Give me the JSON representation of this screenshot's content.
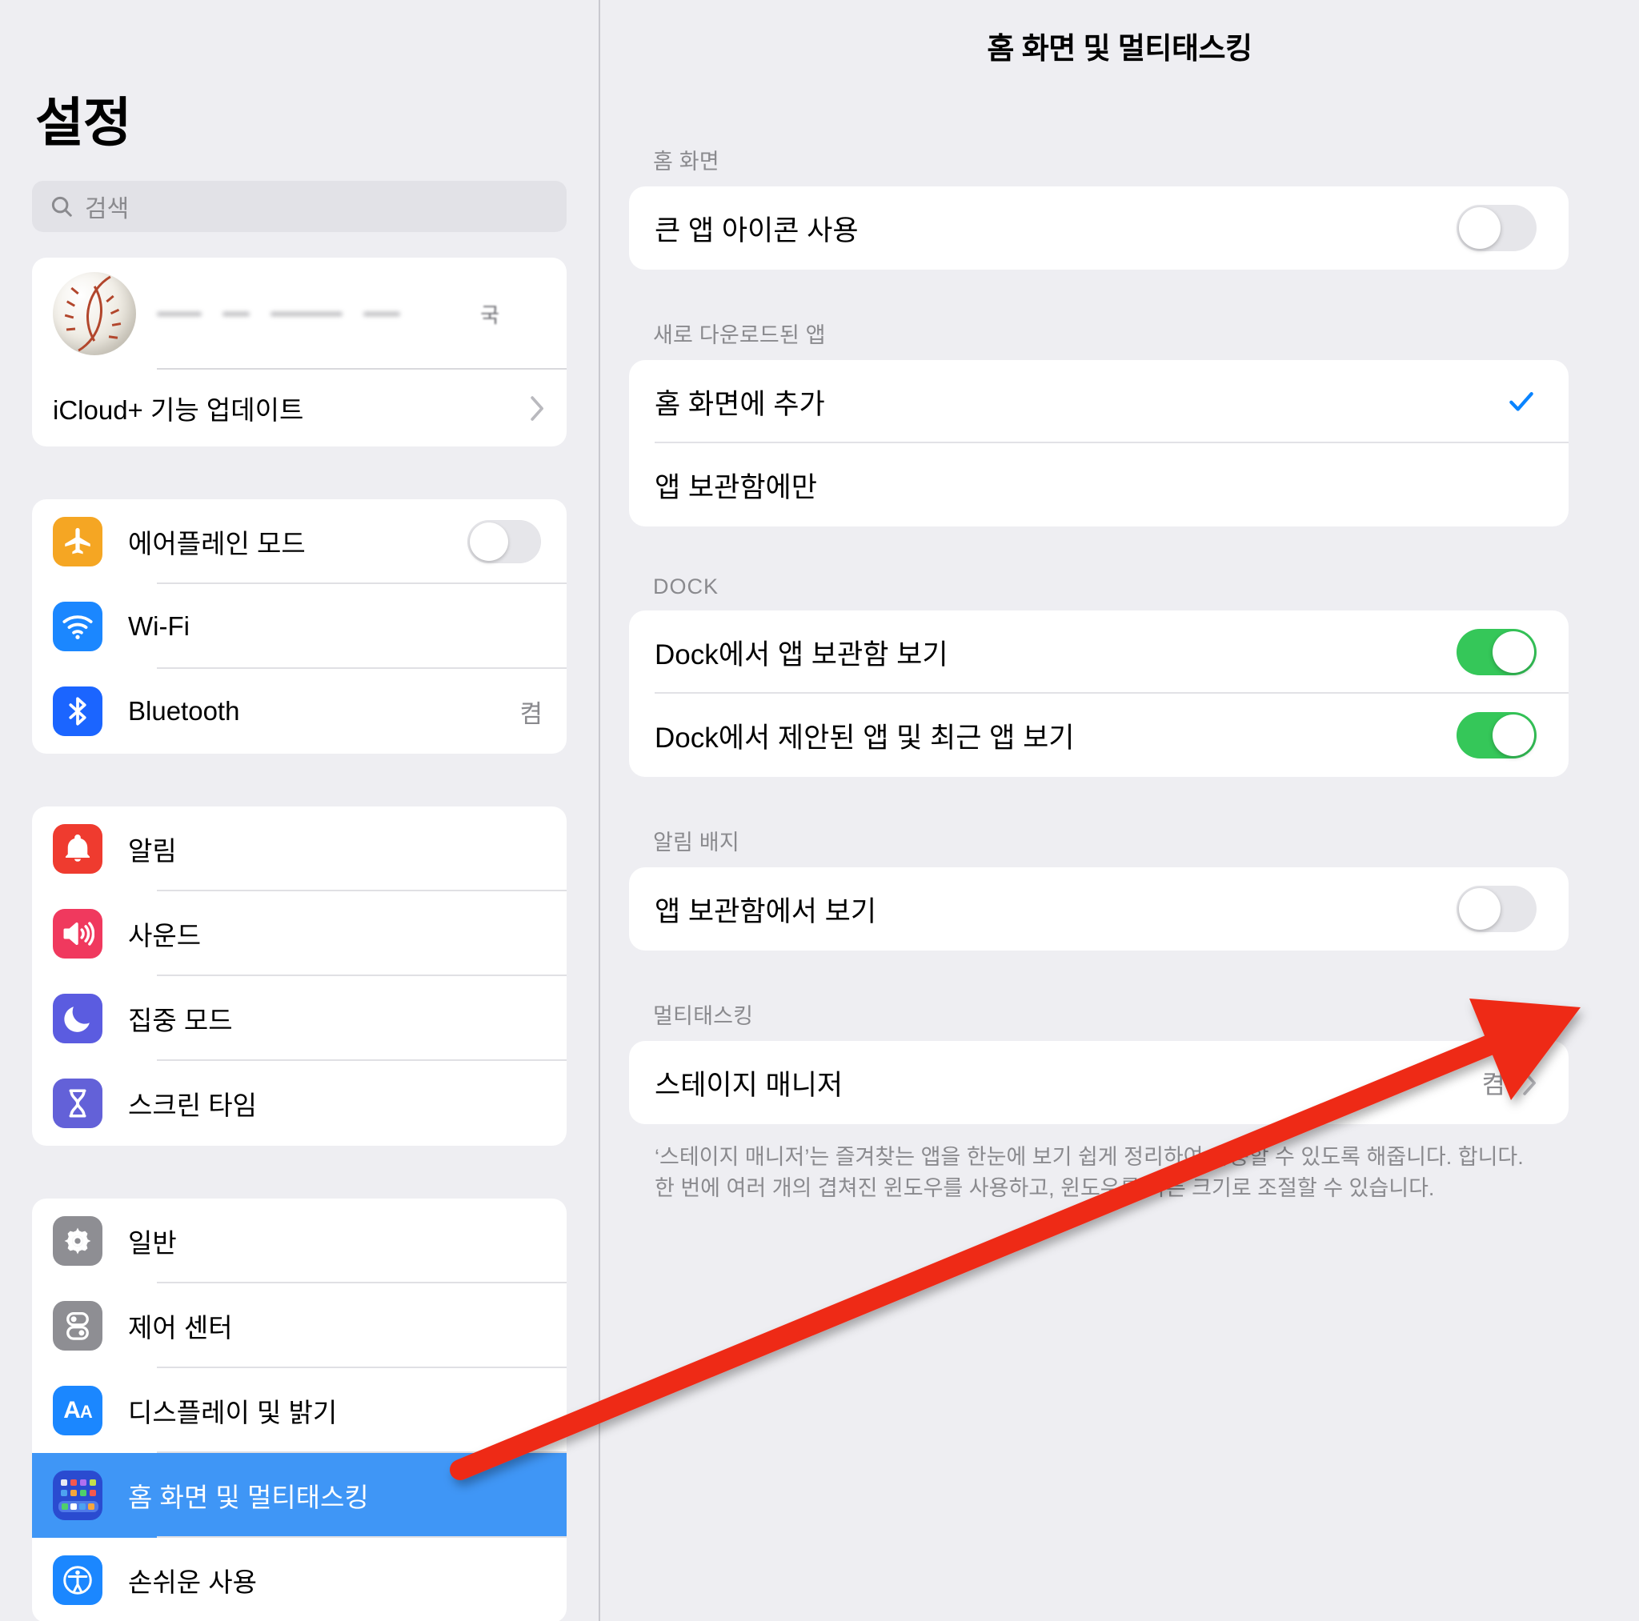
{
  "sidebar": {
    "title": "설정",
    "search": {
      "placeholder": "검색",
      "icon": "search-icon"
    },
    "profile": {
      "secondary": "국",
      "icloud_label": "iCloud+ 기능 업데이트"
    },
    "groups": [
      {
        "items": [
          {
            "label": "에어플레인 모드",
            "icon": "airplane-icon",
            "color": "#f5a623",
            "control": "toggle",
            "value": "off"
          },
          {
            "label": "Wi-Fi",
            "icon": "wifi-icon",
            "color": "#1b87ff",
            "control": "none"
          },
          {
            "label": "Bluetooth",
            "icon": "bluetooth-icon",
            "color": "#1b65ff",
            "control": "value",
            "value": "켬"
          }
        ]
      },
      {
        "items": [
          {
            "label": "알림",
            "icon": "bell-icon",
            "color": "#ef3b2f",
            "control": "none"
          },
          {
            "label": "사운드",
            "icon": "speaker-icon",
            "color": "#f0395e",
            "control": "none"
          },
          {
            "label": "집중 모드",
            "icon": "moon-icon",
            "color": "#5b5ce0",
            "control": "none"
          },
          {
            "label": "스크린 타임",
            "icon": "hourglass-icon",
            "color": "#6361d8",
            "control": "none"
          }
        ]
      },
      {
        "items": [
          {
            "label": "일반",
            "icon": "gear-icon",
            "color": "#8e8e93",
            "control": "none"
          },
          {
            "label": "제어 센터",
            "icon": "control-center-icon",
            "color": "#8e8e93",
            "control": "none"
          },
          {
            "label": "디스플레이 및 밝기",
            "icon": "display-brightness-icon",
            "color": "#1b87ff",
            "control": "none"
          },
          {
            "label": "홈 화면 및 멀티태스킹",
            "icon": "home-screen-icon",
            "color": "#2a4bd0",
            "control": "none",
            "selected": true
          },
          {
            "label": "손쉬운 사용",
            "icon": "accessibility-icon",
            "color": "#1b87ff",
            "control": "none"
          }
        ]
      }
    ]
  },
  "detail": {
    "title": "홈 화면 및 멀티태스킹",
    "sections": [
      {
        "header": "홈 화면",
        "rows": [
          {
            "label": "큰 앱 아이콘 사용",
            "control": "toggle",
            "value": "off"
          }
        ]
      },
      {
        "header": "새로 다운로드된 앱",
        "rows": [
          {
            "label": "홈 화면에 추가",
            "control": "check",
            "value": "checked"
          },
          {
            "label": "앱 보관함에만",
            "control": "none"
          }
        ]
      },
      {
        "header": "DOCK",
        "rows": [
          {
            "label": "Dock에서 앱 보관함 보기",
            "control": "toggle",
            "value": "on"
          },
          {
            "label": "Dock에서 제안된 앱 및 최근 앱 보기",
            "control": "toggle",
            "value": "on"
          }
        ]
      },
      {
        "header": "알림 배지",
        "rows": [
          {
            "label": "앱 보관함에서 보기",
            "control": "toggle",
            "value": "off"
          }
        ]
      },
      {
        "header": "멀티태스킹",
        "rows": [
          {
            "label": "스테이지 매니저",
            "control": "value-chevron",
            "value": "켬"
          }
        ],
        "footnote": "‘스테이지 매니저’는 즐겨찾는 앱을 한눈에 보기 쉽게 정리하여 사용할 수 있도록 해줍니다. 합니다. 한 번에 여러 개의 겹쳐진 윈도우를 사용하고, 윈도우를 다른 크기로 조절할 수 있습니다."
      }
    ]
  },
  "annotation": {
    "arrow_color": "#ee2b18",
    "target": "스테이지 매니저"
  },
  "colors": {
    "accent": "#0a84ff",
    "toggle_on": "#35c759",
    "selection": "#3f96f6",
    "background": "#eeeef2"
  }
}
